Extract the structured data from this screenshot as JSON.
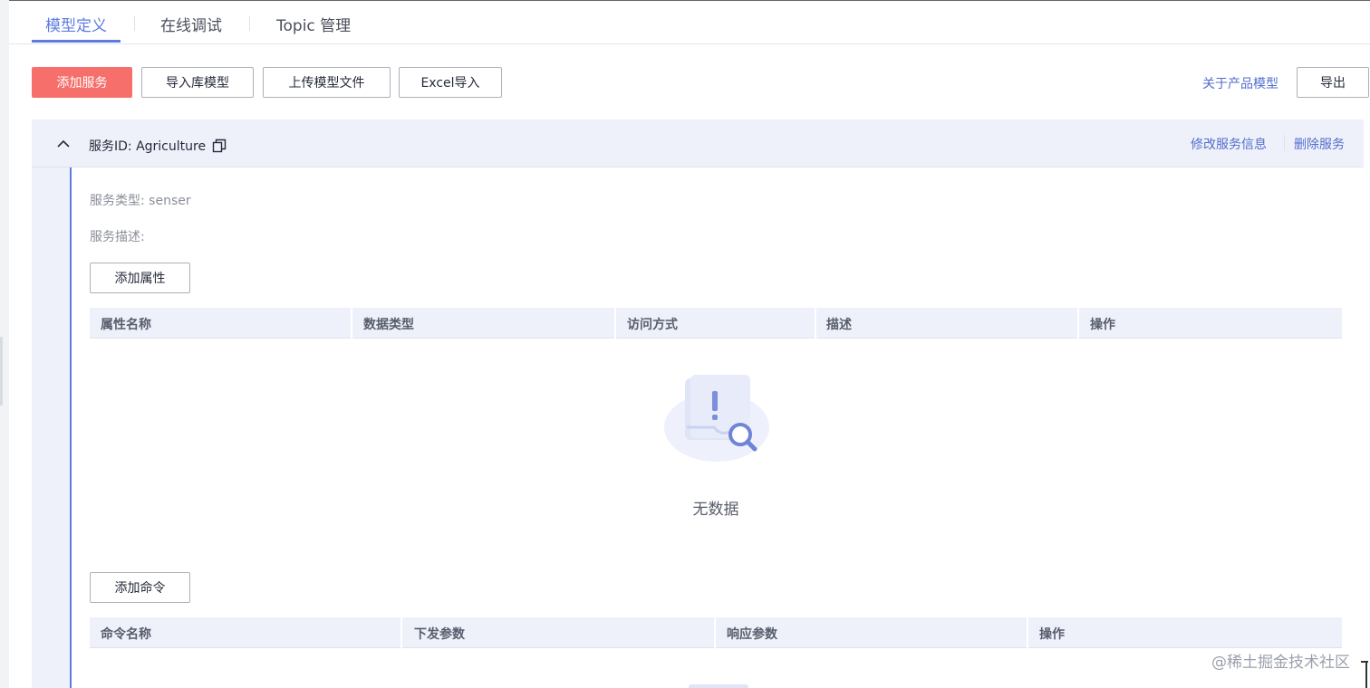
{
  "tabs": [
    {
      "label": "模型定义",
      "active": true
    },
    {
      "label": "在线调试",
      "active": false
    },
    {
      "label": "Topic 管理",
      "active": false
    }
  ],
  "toolbar": {
    "add_service": "添加服务",
    "import_library_model": "导入库模型",
    "upload_model_file": "上传模型文件",
    "excel_import": "Excel导入",
    "about_product_model": "关于产品模型",
    "export": "导出"
  },
  "service": {
    "title": "服务ID: Agriculture",
    "edit_info": "修改服务信息",
    "delete": "删除服务",
    "type_line": "服务类型: senser",
    "desc_line": "服务描述:"
  },
  "properties": {
    "add_button": "添加属性",
    "columns": [
      "属性名称",
      "数据类型",
      "访问方式",
      "描述",
      "操作"
    ],
    "empty_text": "无数据"
  },
  "commands": {
    "add_button": "添加命令",
    "columns": [
      "命令名称",
      "下发参数",
      "响应参数",
      "操作"
    ]
  },
  "watermark": "@稀土掘金技术社区",
  "colors": {
    "accent": "#5e7ce0",
    "primary_button": "#f66f6a",
    "link": "#526ecc",
    "header_bg": "#eef1fa"
  }
}
